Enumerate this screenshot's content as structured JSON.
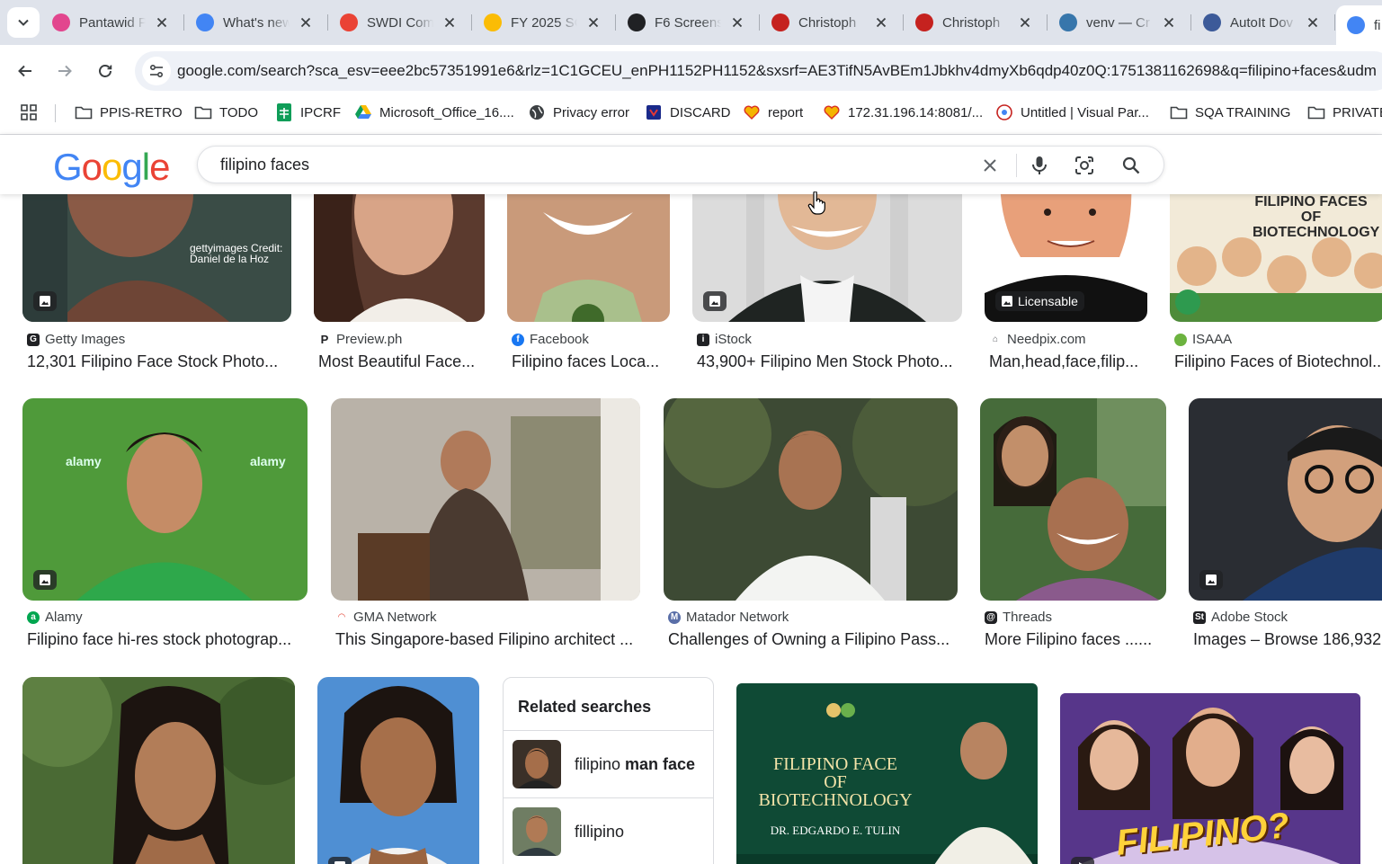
{
  "browser": {
    "tabs": [
      {
        "title": "Pantawid P",
        "icon": "heart-logo",
        "color": "#e2468e"
      },
      {
        "title": "What's new",
        "icon": "chrome-logo",
        "color": "#4285f4"
      },
      {
        "title": "SWDI Com",
        "icon": "gmail-logo",
        "color": "#ea4335"
      },
      {
        "title": "FY 2025 SC",
        "icon": "drive-logo",
        "color": "#fbbc05"
      },
      {
        "title": "F6 Screens",
        "icon": "openai-logo",
        "color": "#202124"
      },
      {
        "title": "Christoph",
        "icon": "avatar",
        "color": "#c5221f"
      },
      {
        "title": "Christoph",
        "icon": "avatar",
        "color": "#c5221f"
      },
      {
        "title": "venv — Cr",
        "icon": "python-logo",
        "color": "#3776ab"
      },
      {
        "title": "AutoIt Dov",
        "icon": "autoit-logo",
        "color": "#3c5a99"
      },
      {
        "title": "fi",
        "icon": "google-logo",
        "color": "#4285f4"
      }
    ],
    "url": "google.com/search?sca_esv=eee2bc57351991e6&rlz=1C1GCEU_enPH1152PH1152&sxsrf=AE3TifN5AvBEm1Jbkhv4dmyXb6qdp40z0Q:1751381162698&q=filipino+faces&udm",
    "bookmarks": [
      {
        "label": "PPIS-RETRO",
        "icon": "folder-icon"
      },
      {
        "label": "TODO",
        "icon": "folder-icon"
      },
      {
        "label": "IPCRF",
        "icon": "sheets-icon"
      },
      {
        "label": "Microsoft_Office_16....",
        "icon": "drive-icon"
      },
      {
        "label": "Privacy error",
        "icon": "globe-icon"
      },
      {
        "label": "DISCARD",
        "icon": "shield-icon"
      },
      {
        "label": "report",
        "icon": "heart-icon"
      },
      {
        "label": "172.31.196.14:8081/...",
        "icon": "heart-icon"
      },
      {
        "label": "Untitled | Visual Par...",
        "icon": "vp-icon"
      },
      {
        "label": "SQA TRAINING",
        "icon": "folder-icon"
      },
      {
        "label": "PRIVATE",
        "icon": "folder-icon"
      }
    ]
  },
  "google": {
    "logo": [
      "G",
      "o",
      "o",
      "g",
      "l",
      "e"
    ],
    "query": "filipino faces"
  },
  "results": {
    "row1": [
      {
        "source": "Getty Images",
        "title": "12,301 Filipino Face Stock Photo...",
        "overlay": "gettyimages Credit: Daniel de la Hoz"
      },
      {
        "source": "Preview.ph",
        "title": "Most Beautiful Face..."
      },
      {
        "source": "Facebook",
        "title": "Filipino faces Loca..."
      },
      {
        "source": "iStock",
        "title": "43,900+ Filipino Men Stock Photo..."
      },
      {
        "source": "Needpix.com",
        "title": "Man,head,face,filip...",
        "badge": "Licensable"
      },
      {
        "source": "ISAAA",
        "title": "Filipino Faces of Biotechnol...",
        "overlay": "FILIPINO FACES OF BIOTECHNOLOGY"
      }
    ],
    "row2": [
      {
        "source": "Alamy",
        "title": "Filipino face hi-res stock photograp...",
        "overlay": "alamy"
      },
      {
        "source": "GMA Network",
        "title": "This Singapore-based Filipino architect ..."
      },
      {
        "source": "Matador Network",
        "title": "Challenges of Owning a Filipino Pass..."
      },
      {
        "source": "Threads",
        "title": "More Filipino faces ......"
      },
      {
        "source": "Adobe Stock",
        "title": "Images – Browse 186,932"
      }
    ],
    "row3": [
      {
        "overlay_lines": [
          "FILIPINO FACE",
          "OF BIOTECHNOLOGY",
          "DR. EDGARDO E. TULIN"
        ]
      },
      {
        "overlay": "FILIPINO?"
      }
    ]
  },
  "related": {
    "heading": "Related searches",
    "items": [
      {
        "prefix": "filipino ",
        "bold": "man face"
      },
      {
        "prefix": "fillipino",
        "bold": ""
      }
    ]
  }
}
